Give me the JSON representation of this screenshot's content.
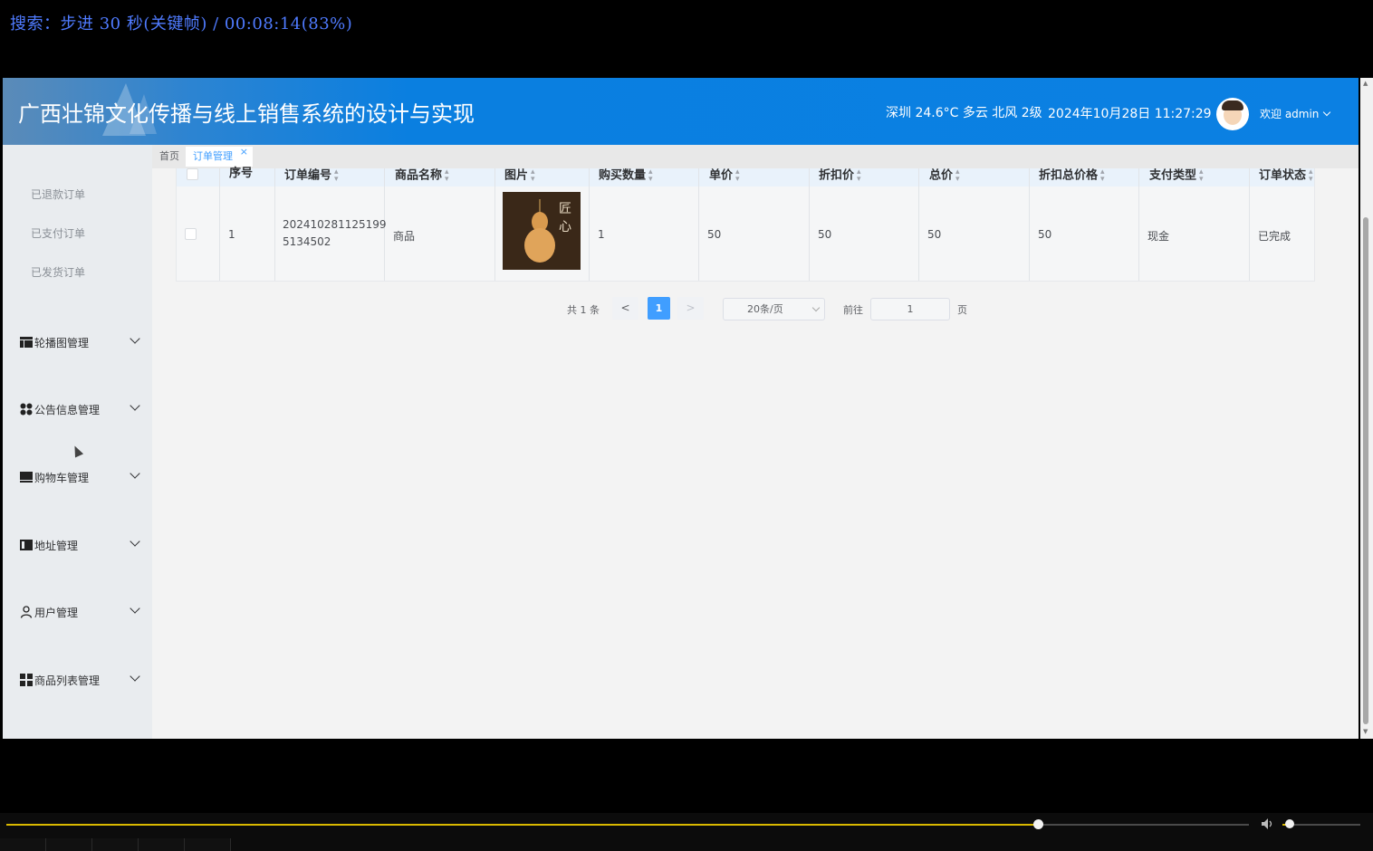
{
  "player": {
    "osd_text": "搜索：步进 30 秒(关键帧) / 00:08:14(83%)",
    "progress_fraction": 0.83,
    "volume_fraction": 0.09
  },
  "header": {
    "title": "广西壮锦文化传播与线上销售系统的设计与实现",
    "weather": "深圳 24.6°C 多云 北风 2级",
    "datetime": "2024年10月28日 11:27:29",
    "user_label": "欢迎 admin"
  },
  "sidebar": {
    "sub_items": [
      {
        "label": "已退款订单"
      },
      {
        "label": "已支付订单"
      },
      {
        "label": "已发货订单"
      }
    ],
    "menus": [
      {
        "label": "轮播图管理",
        "icon": "carousel-icon"
      },
      {
        "label": "公告信息管理",
        "icon": "grid-dots-icon"
      },
      {
        "label": "购物车管理",
        "icon": "monitor-icon"
      },
      {
        "label": "地址管理",
        "icon": "card-icon"
      },
      {
        "label": "用户管理",
        "icon": "user-icon"
      },
      {
        "label": "商品列表管理",
        "icon": "apps-icon"
      }
    ]
  },
  "tabs": [
    {
      "label": "首页"
    },
    {
      "label": "订单管理",
      "close": "×"
    }
  ],
  "table": {
    "columns": [
      "序号",
      "订单编号",
      "商品名称",
      "图片",
      "购买数量",
      "单价",
      "折扣价",
      "总价",
      "折扣总价格",
      "支付类型",
      "订单状态"
    ],
    "rows": [
      {
        "index": "1",
        "order_no_line1": "202410281125199",
        "order_no_line2": "5134502",
        "product_name": "商品",
        "image_seal": "匠心",
        "quantity": "1",
        "unit_price": "50",
        "discount_price": "50",
        "total_price": "50",
        "discount_total": "50",
        "payment_type": "现金",
        "status": "已完成"
      }
    ]
  },
  "pagination": {
    "total_text": "共 1 条",
    "prev": "<",
    "current_page": "1",
    "next": ">",
    "page_size": "20条/页",
    "goto_label": "前往",
    "goto_value": "1",
    "goto_unit": "页"
  },
  "colors": {
    "header_blue": "#0b80e3",
    "accent": "#409eff",
    "progress": "#d9b800"
  }
}
